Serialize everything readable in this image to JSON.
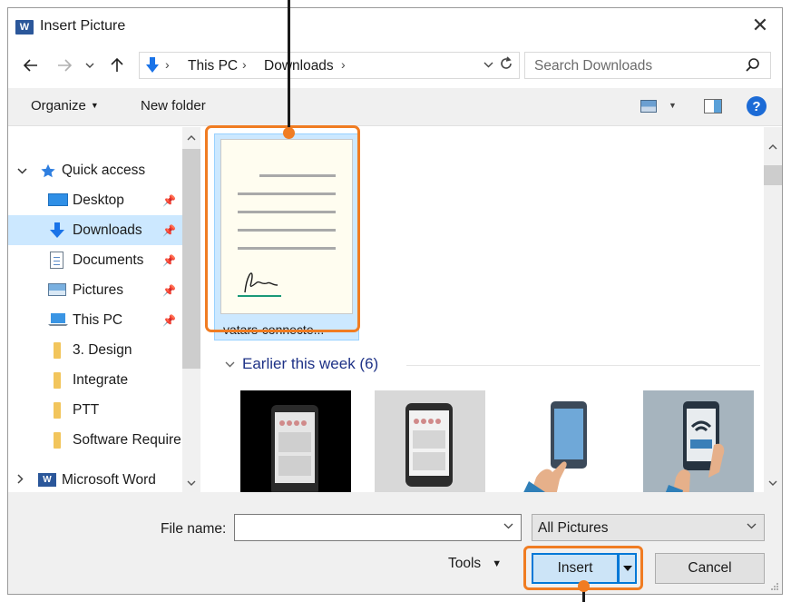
{
  "window": {
    "title": "Insert Picture",
    "app_badge": "W",
    "close_label": "✕"
  },
  "address": {
    "segments": [
      "This PC",
      "Downloads"
    ],
    "search_placeholder": "Search Downloads"
  },
  "toolbar": {
    "organize_label": "Organize",
    "new_folder_label": "New folder",
    "help_label": "?"
  },
  "nav": {
    "items": [
      {
        "label": "Quick access",
        "icon": "star-icon"
      },
      {
        "label": "Desktop",
        "icon": "desktop-icon",
        "pinned": true
      },
      {
        "label": "Downloads",
        "icon": "downloads-icon",
        "pinned": true,
        "selected": true
      },
      {
        "label": "Documents",
        "icon": "documents-icon",
        "pinned": true
      },
      {
        "label": "Pictures",
        "icon": "pictures-icon",
        "pinned": true
      },
      {
        "label": "This PC",
        "icon": "computer-icon",
        "pinned": true
      },
      {
        "label": "3. Design",
        "icon": "folder-icon"
      },
      {
        "label": "Integrate",
        "icon": "folder-icon"
      },
      {
        "label": "PTT",
        "icon": "folder-icon"
      },
      {
        "label": "Software Require",
        "icon": "folder-icon"
      },
      {
        "label": "Microsoft Word",
        "icon": "word-icon"
      }
    ]
  },
  "content": {
    "selected_file": "vatars-connecte...",
    "group_header": "Earlier this week (6)"
  },
  "bottom": {
    "file_name_label": "File name:",
    "file_name_value": "",
    "file_type_value": "All Pictures",
    "tools_label": "Tools",
    "insert_label": "Insert",
    "cancel_label": "Cancel"
  },
  "colors": {
    "accent": "#0078d7",
    "highlight": "#f07c22",
    "selection": "#cce8ff",
    "group_header": "#1e3287"
  }
}
